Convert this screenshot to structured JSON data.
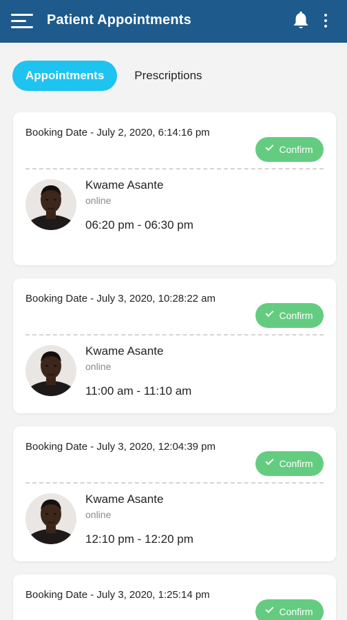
{
  "header": {
    "title": "Patient Appointments"
  },
  "tabs": [
    {
      "label": "Appointments",
      "active": true
    },
    {
      "label": "Prescriptions",
      "active": false
    }
  ],
  "appointments": [
    {
      "booking": "Booking Date - July 2, 2020, 6:14:16 pm",
      "status": "Confirm",
      "patient": "Kwame Asante",
      "mode": "online",
      "time": "06:20 pm - 06:30 pm"
    },
    {
      "booking": "Booking Date - July 3, 2020, 10:28:22 am",
      "status": "Confirm",
      "patient": "Kwame Asante",
      "mode": "online",
      "time": "11:00 am - 11:10 am"
    },
    {
      "booking": "Booking Date - July 3, 2020, 12:04:39 pm",
      "status": "Confirm",
      "patient": "Kwame Asante",
      "mode": "online",
      "time": "12:10 pm - 12:20 pm"
    },
    {
      "booking": "Booking Date - July 3, 2020, 1:25:14 pm",
      "status": "Confirm"
    }
  ],
  "colors": {
    "appbar": "#1e5a8c",
    "tab_active": "#1ec3f0",
    "confirm": "#64cc80",
    "background": "#f3f3f3"
  }
}
